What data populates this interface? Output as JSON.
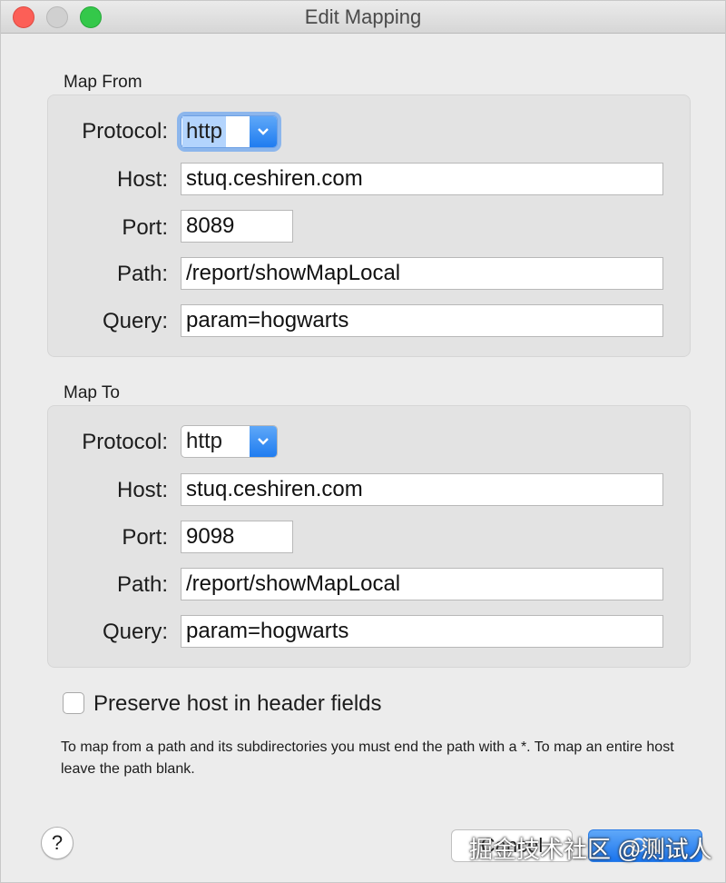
{
  "window": {
    "title": "Edit Mapping"
  },
  "map_from": {
    "label": "Map From",
    "protocol_label": "Protocol:",
    "protocol": "http",
    "host_label": "Host:",
    "host": "stuq.ceshiren.com",
    "port_label": "Port:",
    "port": "8089",
    "path_label": "Path:",
    "path": "/report/showMapLocal",
    "query_label": "Query:",
    "query": "param=hogwarts"
  },
  "map_to": {
    "label": "Map To",
    "protocol_label": "Protocol:",
    "protocol": "http",
    "host_label": "Host:",
    "host": "stuq.ceshiren.com",
    "port_label": "Port:",
    "port": "9098",
    "path_label": "Path:",
    "path": "/report/showMapLocal",
    "query_label": "Query:",
    "query": "param=hogwarts"
  },
  "preserve_host": {
    "label": "Preserve host in header fields",
    "checked": false
  },
  "hint": "To map from a path and its subdirectories you must end the path with a *. To map an entire host leave the path blank.",
  "help_label": "?",
  "buttons": {
    "cancel": "Cancel",
    "ok": "OK"
  },
  "watermark": "掘金技术社区 @测试人",
  "colors": {
    "accent": "#1f7cf0",
    "focus_ring": "#8cb6ec",
    "close": "#fc5f57",
    "maximize": "#34c84a"
  }
}
